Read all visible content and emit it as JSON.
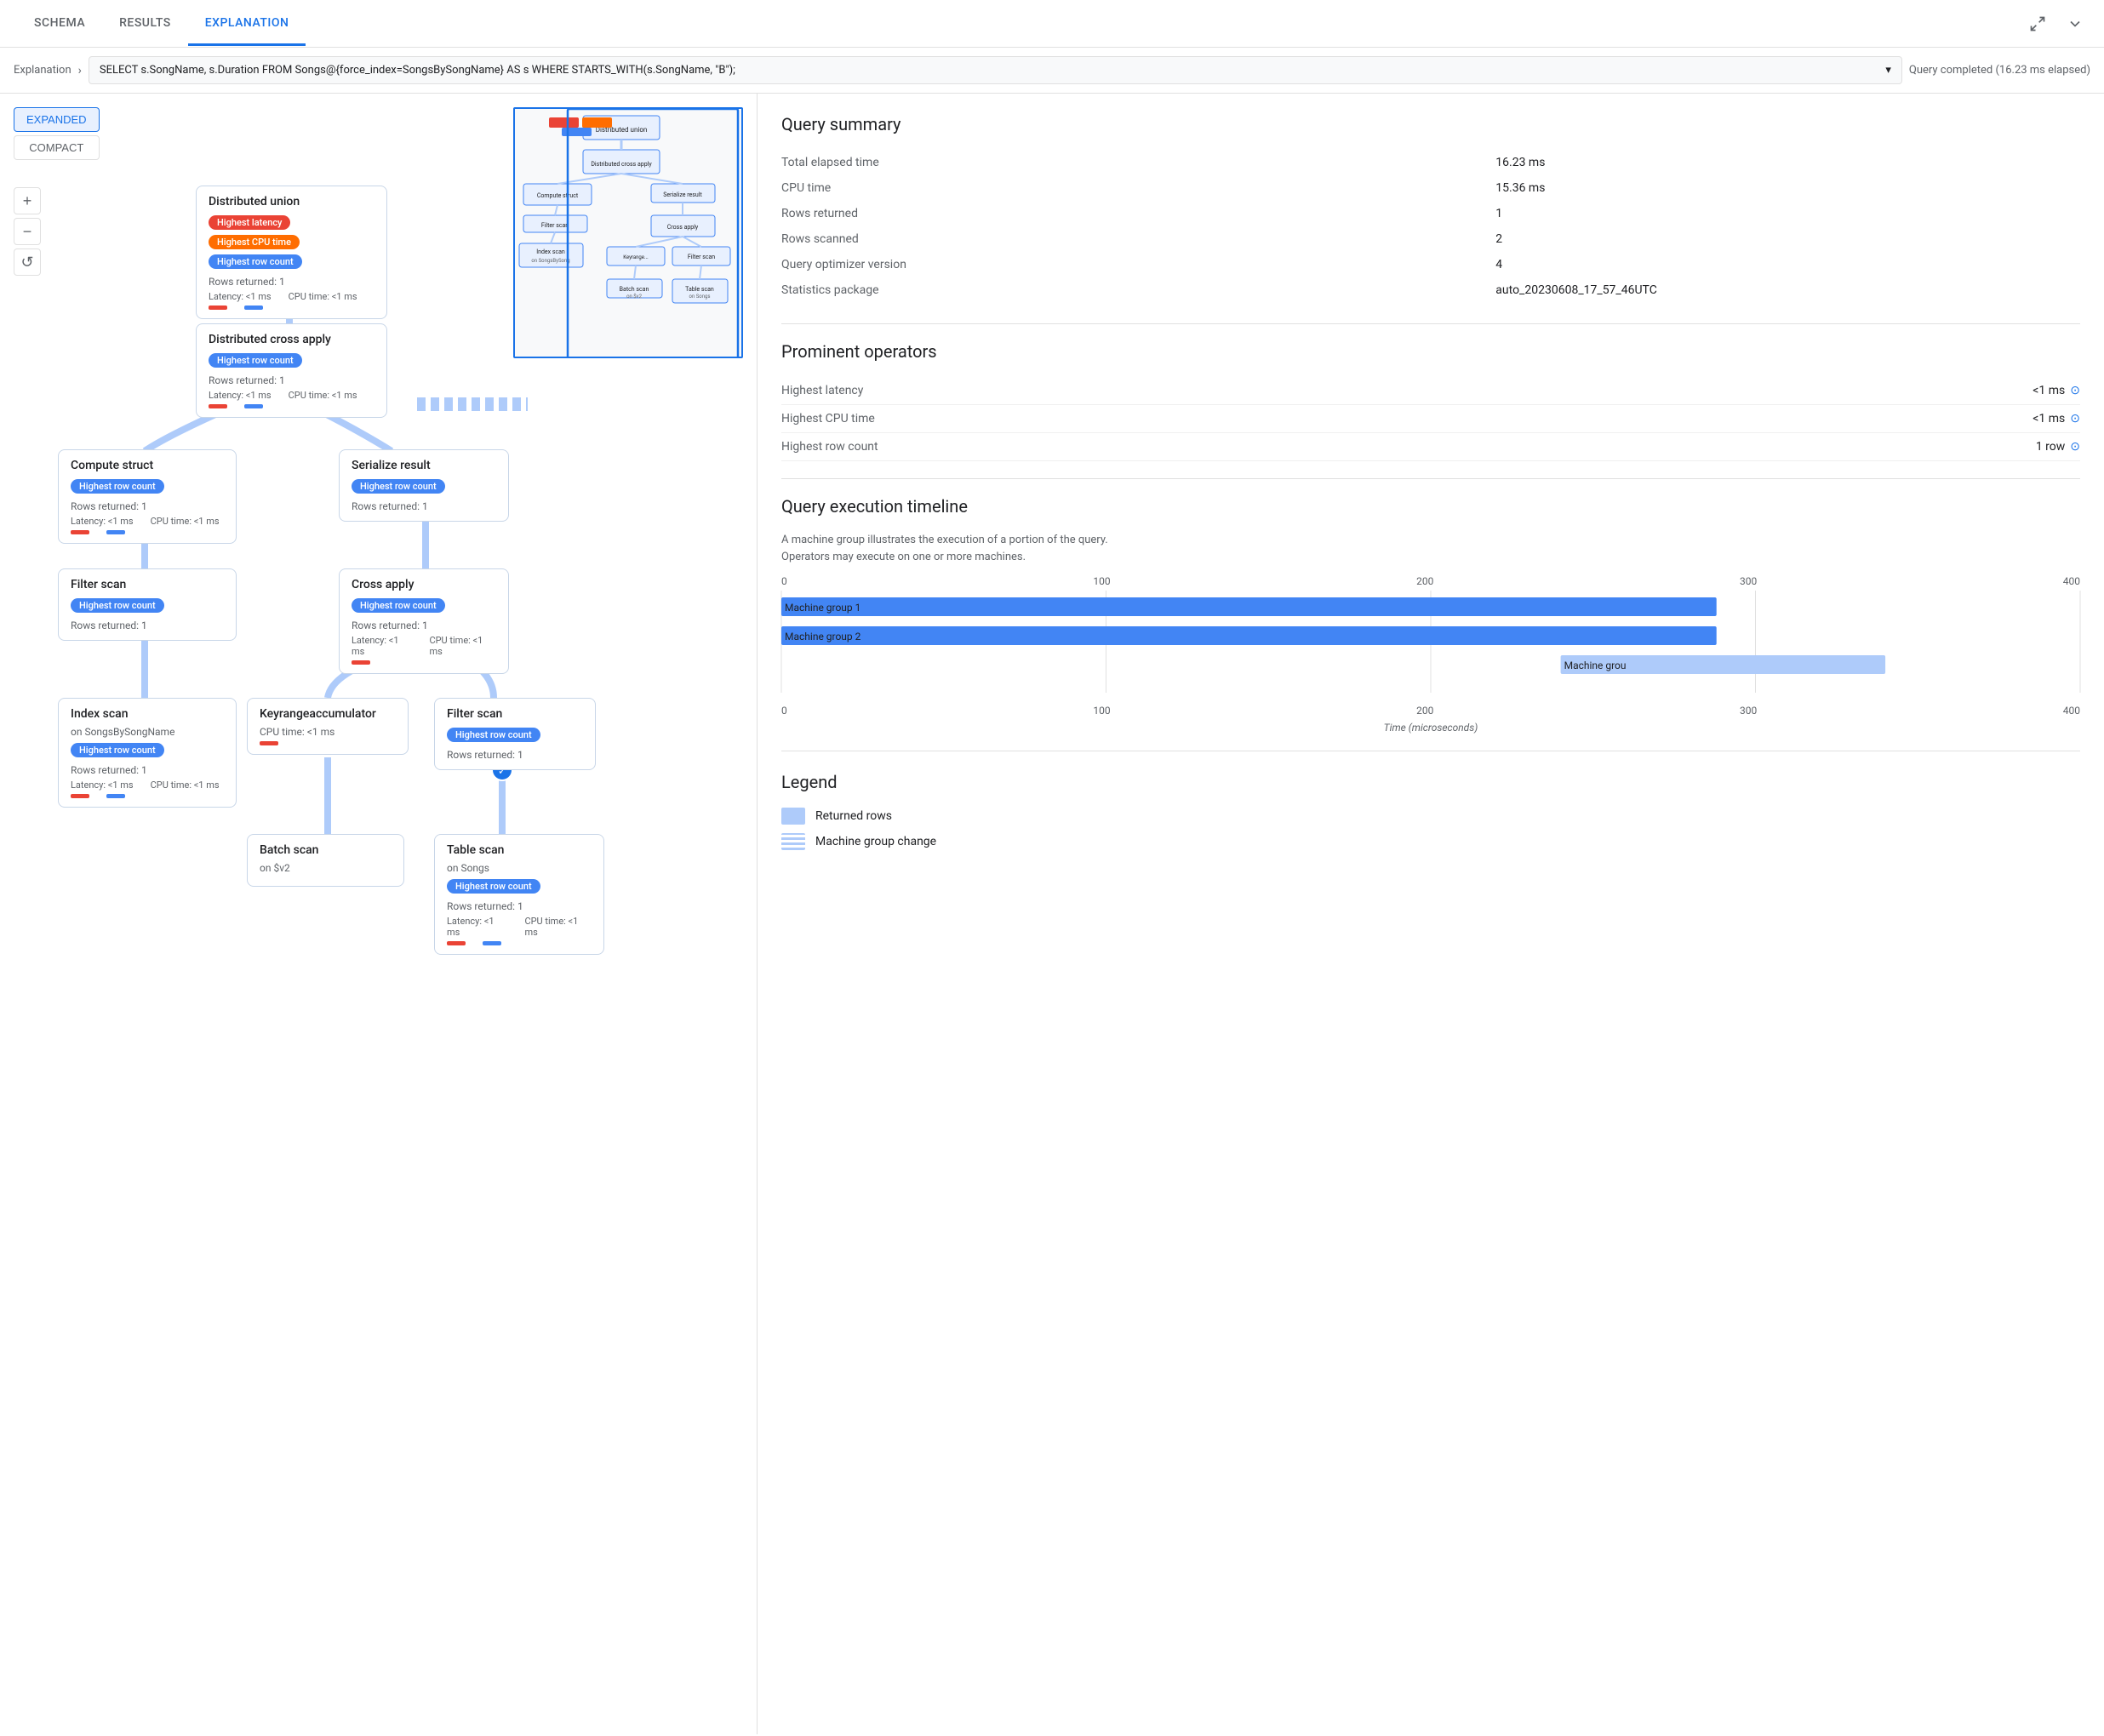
{
  "tabs": {
    "items": [
      "SCHEMA",
      "RESULTS",
      "EXPLANATION"
    ],
    "active": "EXPLANATION"
  },
  "header": {
    "breadcrumb": "Explanation",
    "query": "SELECT s.SongName, s.Duration FROM Songs@{force_index=SongsBySongName} AS s WHERE STARTS_WITH(s.SongName, \"B\");",
    "status": "Query completed (16.23 ms elapsed)"
  },
  "view_toggle": {
    "expanded": "EXPANDED",
    "compact": "COMPACT"
  },
  "zoom": {
    "plus": "+",
    "minus": "−",
    "reset": "↺"
  },
  "nodes": {
    "distributed_union": {
      "title": "Distributed union",
      "badges": [
        "Highest latency",
        "Highest CPU time",
        "Highest row count"
      ],
      "rows_returned": "Rows returned: 1",
      "latency": "Latency: <1 ms",
      "cpu": "CPU time: <1 ms"
    },
    "distributed_cross_apply": {
      "title": "Distributed cross apply",
      "badges": [
        "Highest row count"
      ],
      "rows_returned": "Rows returned: 1",
      "latency": "Latency: <1 ms",
      "cpu": "CPU time: <1 ms"
    },
    "compute_struct": {
      "title": "Compute struct",
      "badges": [
        "Highest row count"
      ],
      "rows_returned": "Rows returned: 1",
      "latency": "Latency: <1 ms",
      "cpu": "CPU time: <1 ms"
    },
    "serialize_result": {
      "title": "Serialize result",
      "badges": [
        "Highest row count"
      ],
      "rows_returned": "Rows returned: 1"
    },
    "filter_scan_1": {
      "title": "Filter scan",
      "badges": [
        "Highest row count"
      ],
      "rows_returned": "Rows returned: 1"
    },
    "cross_apply": {
      "title": "Cross apply",
      "badges": [
        "Highest row count"
      ],
      "rows_returned": "Rows returned: 1",
      "latency": "Latency: <1 ms",
      "cpu": "CPU time: <1 ms"
    },
    "index_scan": {
      "title": "Index scan",
      "subtitle": "on SongsBySongName",
      "badges": [
        "Highest row count"
      ],
      "rows_returned": "Rows returned: 1",
      "latency": "Latency: <1 ms",
      "cpu": "CPU time: <1 ms"
    },
    "keyrange_accumulator": {
      "title": "Keyrangeaccumulator",
      "cpu": "CPU time: <1 ms"
    },
    "filter_scan_2": {
      "title": "Filter scan",
      "badges": [
        "Highest row count"
      ],
      "rows_returned": "Rows returned: 1"
    },
    "batch_scan": {
      "title": "Batch scan",
      "subtitle": "on $v2"
    },
    "table_scan": {
      "title": "Table scan",
      "subtitle": "on Songs",
      "badges": [
        "Highest row count"
      ],
      "rows_returned": "Rows returned: 1",
      "latency": "Latency: <1 ms",
      "cpu": "CPU time: <1 ms"
    }
  },
  "query_summary": {
    "title": "Query summary",
    "rows": [
      {
        "label": "Total elapsed time",
        "value": "16.23 ms"
      },
      {
        "label": "CPU time",
        "value": "15.36 ms"
      },
      {
        "label": "Rows returned",
        "value": "1"
      },
      {
        "label": "Rows scanned",
        "value": "2"
      },
      {
        "label": "Query optimizer version",
        "value": "4"
      },
      {
        "label": "Statistics package",
        "value": "auto_20230608_17_57_46UTC"
      }
    ]
  },
  "prominent_operators": {
    "title": "Prominent operators",
    "rows": [
      {
        "label": "Highest latency",
        "value": "<1 ms"
      },
      {
        "label": "Highest CPU time",
        "value": "<1 ms"
      },
      {
        "label": "Highest row count",
        "value": "1 row"
      }
    ]
  },
  "timeline": {
    "title": "Query execution timeline",
    "desc_line1": "A machine group illustrates the execution of a portion of the query.",
    "desc_line2": "Operators may execute on one or more machines.",
    "x_axis_labels": [
      "0",
      "100",
      "200",
      "300",
      "400"
    ],
    "bars": [
      {
        "label": "Machine group 1",
        "start_pct": 0,
        "width_pct": 72,
        "type": "dark"
      },
      {
        "label": "Machine group 2",
        "start_pct": 0,
        "width_pct": 72,
        "type": "dark"
      },
      {
        "label": "Machine grou",
        "start_pct": 60,
        "width_pct": 25,
        "type": "small"
      }
    ],
    "x_axis_bottom": [
      "0",
      "100",
      "200",
      "300",
      "400"
    ],
    "x_label": "Time (microseconds)"
  },
  "legend": {
    "title": "Legend",
    "items": [
      {
        "type": "returned",
        "label": "Returned rows"
      },
      {
        "type": "machine",
        "label": "Machine group change"
      }
    ]
  }
}
